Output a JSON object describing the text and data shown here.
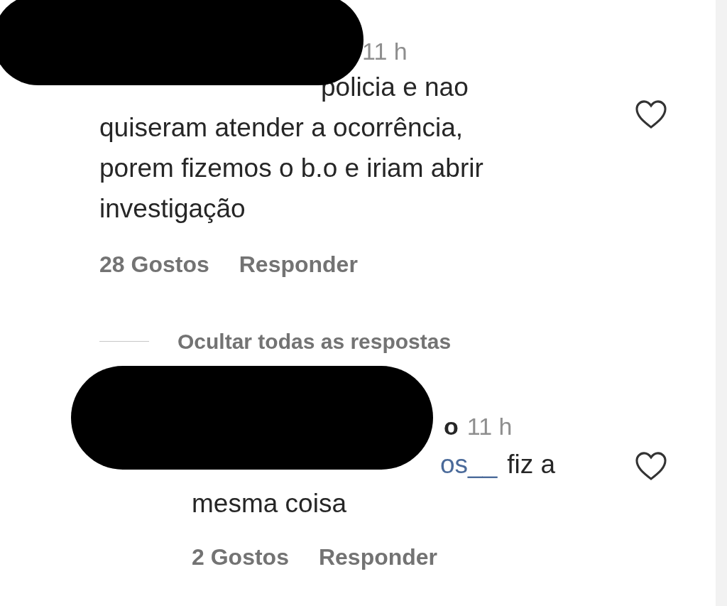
{
  "comment": {
    "time": "11 h",
    "lines": [
      "policia e nao",
      "quiseram atender a ocorrência,",
      "porem fizemos o b.o e iriam abrir",
      "investigação"
    ],
    "liked": false,
    "likes": "28 Gostos",
    "reply_action": "Responder"
  },
  "replies_toggle": "Ocultar todas as respostas",
  "reply": {
    "username": "o",
    "time": "11 h",
    "mention": "os__",
    "lines": [
      "fiz a",
      "mesma coisa"
    ],
    "liked": false,
    "likes": "2 Gostos",
    "reply_action": "Responder"
  }
}
